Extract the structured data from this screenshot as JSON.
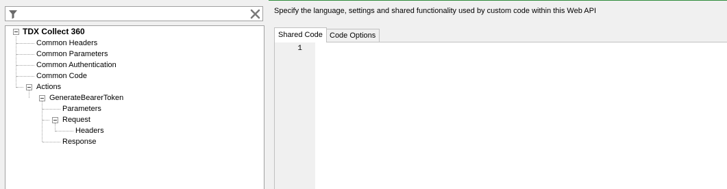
{
  "filter": {
    "value": "",
    "placeholder": ""
  },
  "tree": {
    "root": "TDX Collect 360",
    "common_headers": "Common Headers",
    "common_parameters": "Common Parameters",
    "common_authentication": "Common Authentication",
    "common_code": "Common Code",
    "actions": "Actions",
    "generate_bearer_token": "GenerateBearerToken",
    "parameters": "Parameters",
    "request": "Request",
    "headers": "Headers",
    "response": "Response"
  },
  "description": "Specify the language, settings and shared functionality used by custom code within this Web API",
  "tabs": [
    {
      "label": "Shared Code",
      "active": true
    },
    {
      "label": "Code Options",
      "active": false
    }
  ],
  "editor": {
    "line_numbers": [
      "1"
    ],
    "content": ""
  },
  "colors": {
    "accent_line": "#2e8b3a",
    "panel_border": "#a0a0a0",
    "background": "#f0f0f0"
  },
  "icons": {
    "filter": "funnel-icon",
    "clear": "close-icon"
  }
}
